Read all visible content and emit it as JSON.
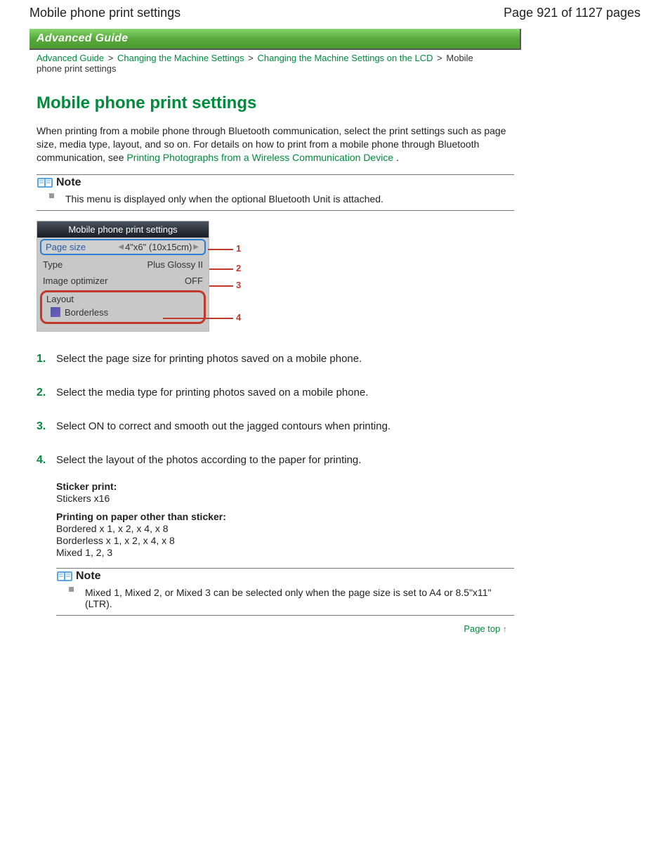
{
  "header": {
    "title": "Mobile phone print settings",
    "pager": "Page 921 of 1127 pages"
  },
  "banner": "Advanced Guide",
  "breadcrumb": {
    "items": [
      {
        "label": "Advanced Guide",
        "link": true
      },
      {
        "label": "Changing the Machine Settings",
        "link": true
      },
      {
        "label": "Changing the Machine Settings on the LCD",
        "link": true
      },
      {
        "label": "Mobile phone print settings",
        "link": false
      }
    ],
    "sep": ">"
  },
  "heading": "Mobile phone print settings",
  "intro": {
    "text_before": "When printing from a mobile phone through Bluetooth communication, select the print settings such as page size, media type, layout, and so on. For details on how to print from a mobile phone through Bluetooth communication, see ",
    "link": "Printing Photographs from a Wireless Communication Device",
    "text_after": " ."
  },
  "notes": [
    {
      "title": "Note",
      "items": [
        "This menu is displayed only when the optional Bluetooth Unit is attached."
      ]
    },
    {
      "title": "Note",
      "items": [
        "Mixed 1, Mixed 2, or Mixed 3 can be selected only when the page size is set to A4 or 8.5\"x11\"(LTR)."
      ]
    }
  ],
  "lcd": {
    "title": "Mobile phone print settings",
    "rows": [
      {
        "label": "Page size",
        "value": "4\"x6\" (10x15cm)"
      },
      {
        "label": "Type",
        "value": "Plus Glossy II"
      },
      {
        "label": "Image optimizer",
        "value": "OFF"
      }
    ],
    "layout": {
      "label": "Layout",
      "value": "Borderless"
    },
    "callouts": [
      "1",
      "2",
      "3",
      "4"
    ]
  },
  "steps": [
    {
      "num": "1.",
      "text": "Select the page size for printing photos saved on a mobile phone."
    },
    {
      "num": "2.",
      "text": "Select the media type for printing photos saved on a mobile phone."
    },
    {
      "num": "3.",
      "text": "Select ON to correct and smooth out the jagged contours when printing."
    },
    {
      "num": "4.",
      "text": "Select the layout of the photos according to the paper for printing."
    }
  ],
  "sub": {
    "sticker_head": "Sticker print:",
    "sticker_line": "Stickers x16",
    "other_head": "Printing on paper other than sticker:",
    "other_lines": [
      "Bordered x 1, x 2, x 4, x 8",
      "Borderless x 1, x 2, x 4, x 8",
      "Mixed 1, 2, 3"
    ]
  },
  "pagetop": "Page top"
}
